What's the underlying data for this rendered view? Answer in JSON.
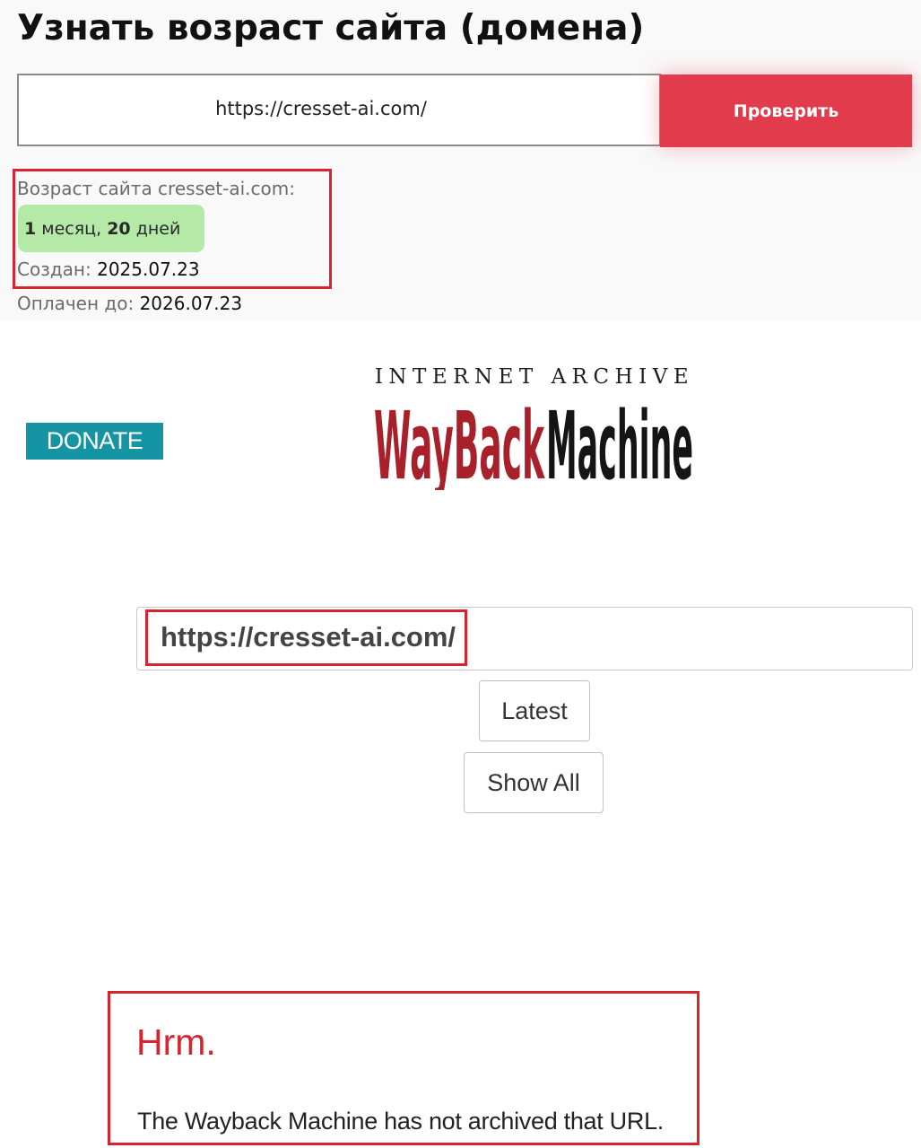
{
  "header": {
    "title": "Узнать возраст сайта (домена)"
  },
  "checker": {
    "input_value": "https://cresset-ai.com/",
    "button_label": "Проверить"
  },
  "result": {
    "age_label": "Возраст сайта cresset-ai.com:",
    "age_num1": "1",
    "age_unit1": "месяц,",
    "age_num2": "20",
    "age_unit2": "дней",
    "created_label": "Создан:",
    "created_value": "2025.07.23",
    "paid_label": "Оплачен до:",
    "paid_value": "2026.07.23"
  },
  "wayback": {
    "donate_label": "DONATE",
    "logo_top": "INTERNET ARCHIVE",
    "logo_way": "WayBack",
    "logo_machine": "Machine",
    "url_value": "https://cresset-ai.com/",
    "latest_label": "Latest",
    "show_all_label": "Show All",
    "error_title": "Hrm.",
    "error_message": "The Wayback Machine has not archived that URL."
  },
  "colors": {
    "accent_red": "#e23b4c",
    "highlight_red": "#d9232f",
    "badge_green": "#b4e9a8",
    "donate_teal": "#1594a3",
    "logo_red": "#a8212a"
  }
}
